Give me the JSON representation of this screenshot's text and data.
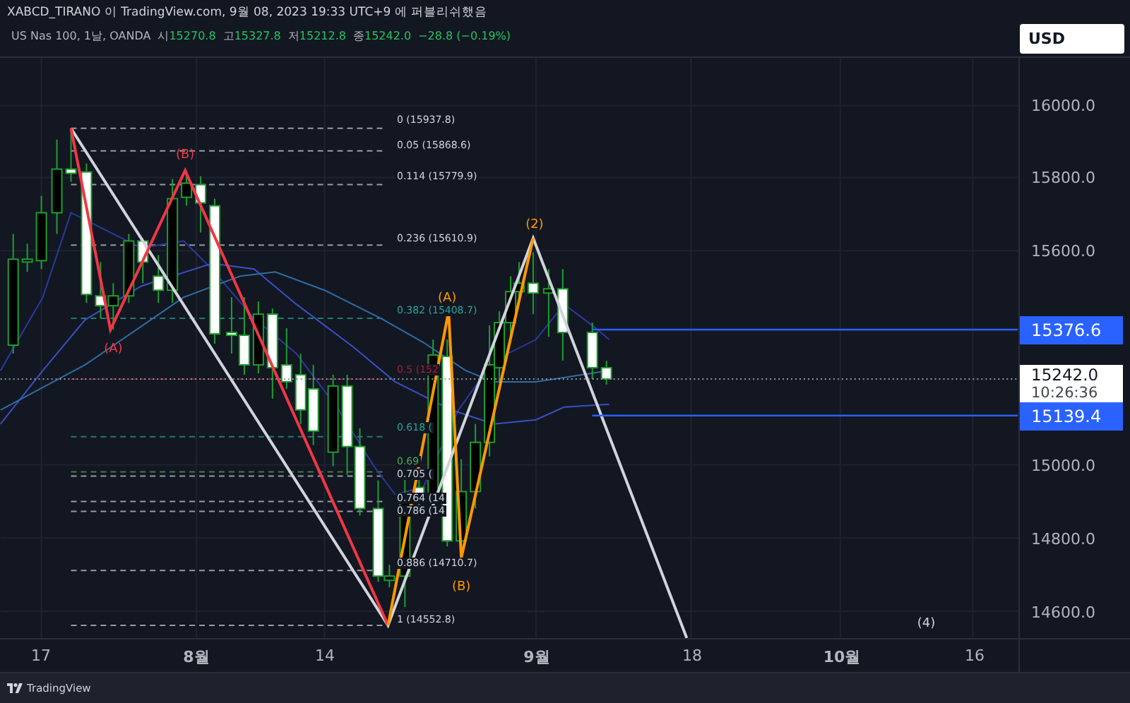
{
  "header": {
    "title": "XABCD_TIRANO 이 TradingView.com, 9월 08, 2023 19:33 UTC+9 에 퍼블리쉬했음",
    "symbol": "US Nas 100, 1날, OANDA",
    "ohlc": [
      {
        "label": "시",
        "value": "15270.8"
      },
      {
        "label": "고",
        "value": "15327.8"
      },
      {
        "label": "저",
        "value": "15212.8"
      },
      {
        "label": "종",
        "value": "15242.0"
      }
    ],
    "change": "−28.8 (−0.19%)"
  },
  "currency": "USD",
  "fib_levels": [
    {
      "label": "0 (15937.8)",
      "color": "#d1d4dc"
    },
    {
      "label": "0.05 (15868.6)",
      "color": "#d1d4dc"
    },
    {
      "label": "0.114 (15779.9)",
      "color": "#d1d4dc"
    },
    {
      "label": "0.236 (15610.9)",
      "color": "#d1d4dc"
    },
    {
      "label": "0.382 (15408.7)",
      "color": "#26a69a"
    },
    {
      "label": "0.5 (152",
      "color": "#a3202c"
    },
    {
      "label": "0.618 (",
      "color": "#26a69a"
    },
    {
      "label": "0.69",
      "color": "#4caf50"
    },
    {
      "label": "0.705 (",
      "color": "#d1d4dc"
    },
    {
      "label": "0.764 (14",
      "color": "#d1d4dc"
    },
    {
      "label": "0.786 (14",
      "color": "#d1d4dc"
    },
    {
      "label": "0.886 (14710.7)",
      "color": "#d1d4dc"
    },
    {
      "label": "1 (14552.8)",
      "color": "#d1d4dc"
    }
  ],
  "wave_labels": [
    {
      "text": "(A)",
      "color": "#f23645"
    },
    {
      "text": "(B)",
      "color": "#f23645"
    },
    {
      "text": "(A)",
      "color": "#ff9800"
    },
    {
      "text": "(B)",
      "color": "#ff9800"
    },
    {
      "text": "(2)",
      "color": "#ff9800"
    },
    {
      "text": "(4)",
      "color": "#d1d4dc"
    }
  ],
  "price_axis": {
    "ticks": [
      "16000.0",
      "15800.0",
      "15600.0",
      "15000.0",
      "14800.0",
      "14600.0"
    ],
    "markers": [
      {
        "kind": "line",
        "value": "15376.6"
      },
      {
        "kind": "current",
        "value": "15242.0",
        "countdown": "10:26:36"
      },
      {
        "kind": "line",
        "value": "15139.4"
      }
    ]
  },
  "time_axis": [
    {
      "label": "17",
      "kind": "day"
    },
    {
      "label": "8월",
      "kind": "month"
    },
    {
      "label": "14",
      "kind": "day"
    },
    {
      "label": "9월",
      "kind": "month"
    },
    {
      "label": "18",
      "kind": "day"
    },
    {
      "label": "10월",
      "kind": "month"
    },
    {
      "label": "16",
      "kind": "day"
    }
  ],
  "footer": {
    "brand": "TradingView"
  }
}
